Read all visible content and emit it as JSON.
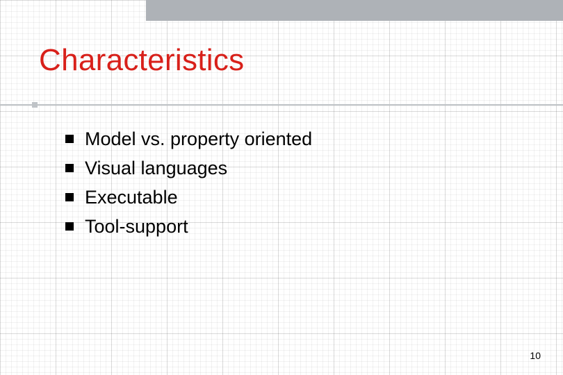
{
  "slide": {
    "title": "Characteristics",
    "bullets": [
      "Model vs. property oriented",
      "Visual languages",
      "Executable",
      "Tool-support"
    ],
    "page_number": "10"
  }
}
